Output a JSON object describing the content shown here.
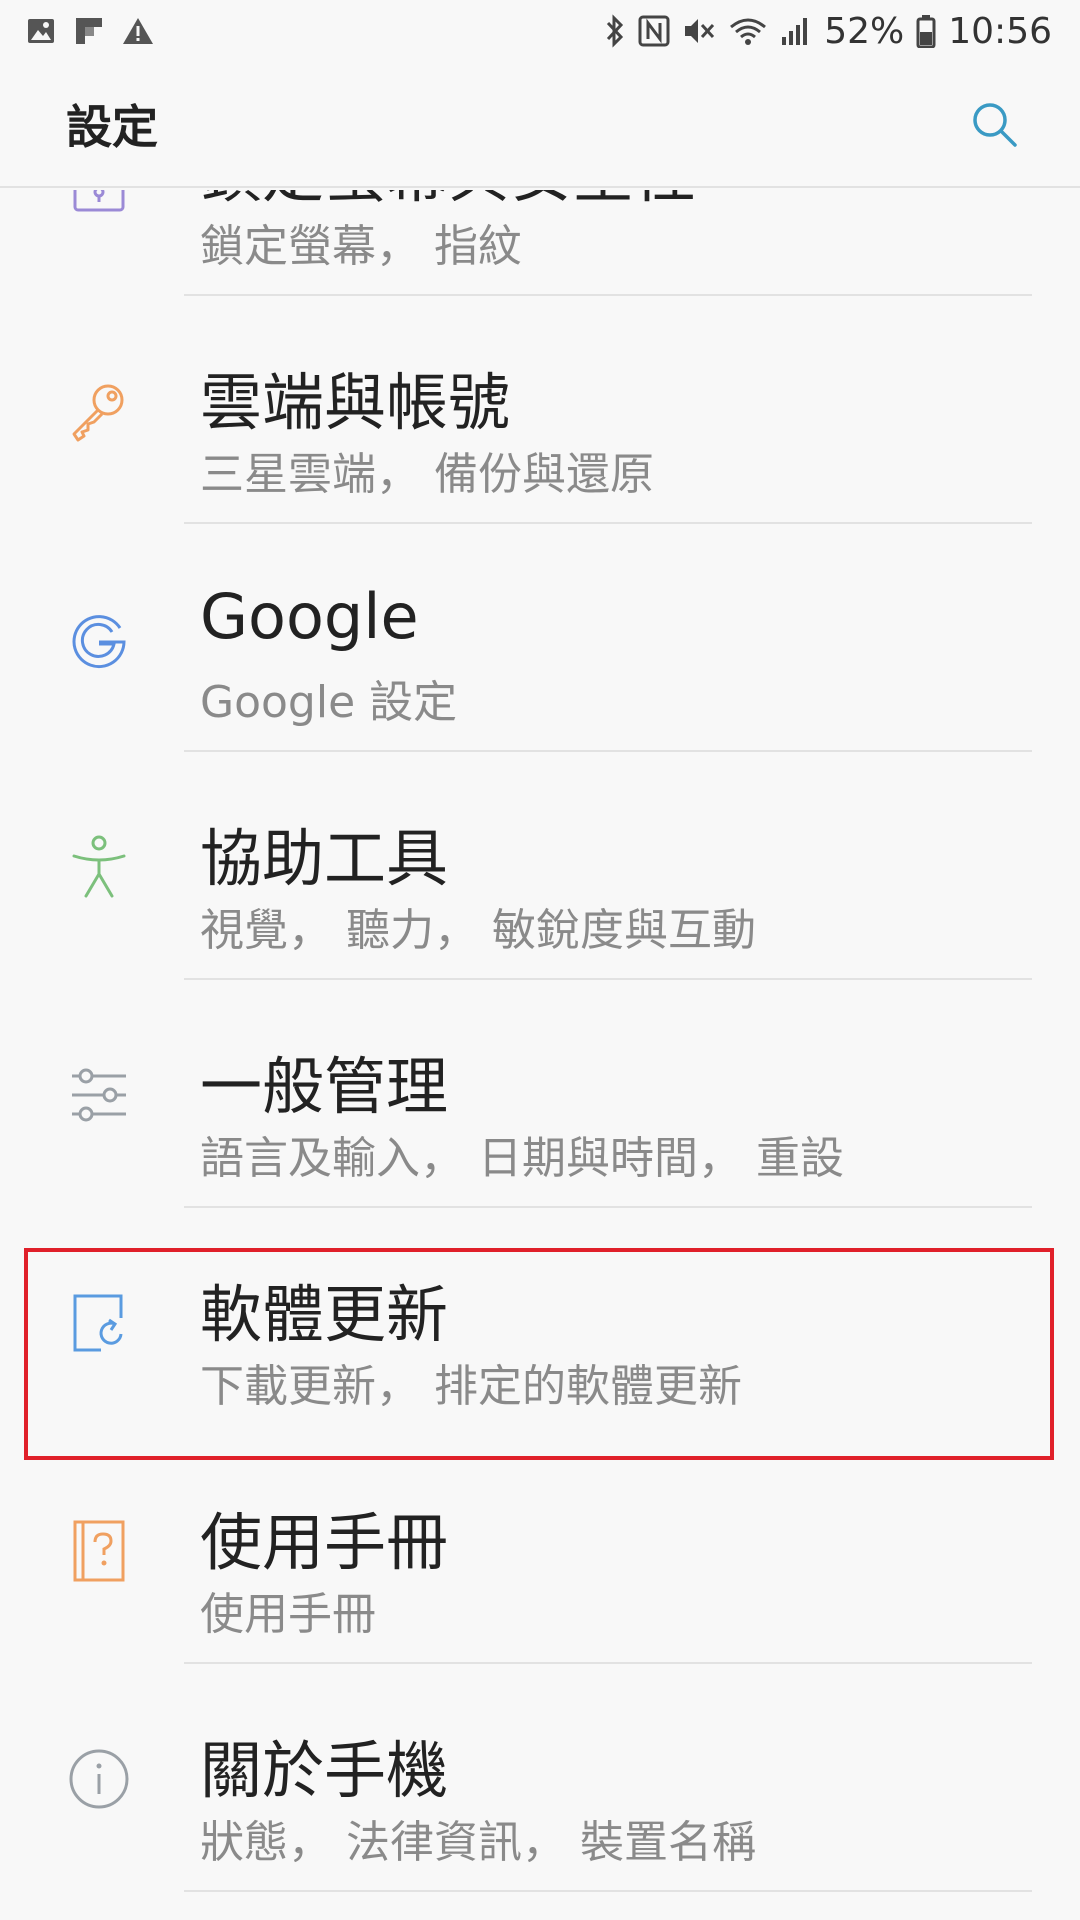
{
  "status_bar": {
    "battery_percent": "52%",
    "time": "10:56",
    "left_icons": [
      "gallery-icon",
      "flipboard-icon",
      "warning-icon"
    ],
    "right_icons": [
      "bluetooth-icon",
      "nfc-icon",
      "mute-icon",
      "wifi-icon",
      "signal-icon",
      "battery-icon"
    ]
  },
  "app_bar": {
    "title": "設定",
    "search_icon": "search-icon"
  },
  "items": [
    {
      "title": "鎖定螢幕與安全性",
      "subtitle": "鎖定螢幕， 指紋",
      "icon": "lock-icon",
      "color": "#9b8ad6"
    },
    {
      "title": "雲端與帳號",
      "subtitle": "三星雲端， 備份與還原",
      "icon": "key-icon",
      "color": "#f0a060"
    },
    {
      "title": "Google",
      "subtitle": "Google 設定",
      "icon": "google-icon",
      "color": "#5b8fe0"
    },
    {
      "title": "協助工具",
      "subtitle": "視覺， 聽力， 敏銳度與互動",
      "icon": "accessibility-icon",
      "color": "#7cc07c"
    },
    {
      "title": "一般管理",
      "subtitle": "語言及輸入， 日期與時間， 重設",
      "icon": "sliders-icon",
      "color": "#9aa0a6"
    },
    {
      "title": "軟體更新",
      "subtitle": "下載更新， 排定的軟體更新",
      "icon": "software-update-icon",
      "color": "#5a9be0"
    },
    {
      "title": "使用手冊",
      "subtitle": "使用手冊",
      "icon": "user-manual-icon",
      "color": "#f0a060"
    },
    {
      "title": "關於手機",
      "subtitle": "狀態， 法律資訊， 裝置名稱",
      "icon": "info-icon",
      "color": "#9aa0a6"
    }
  ],
  "highlight_color": "#e0202a"
}
